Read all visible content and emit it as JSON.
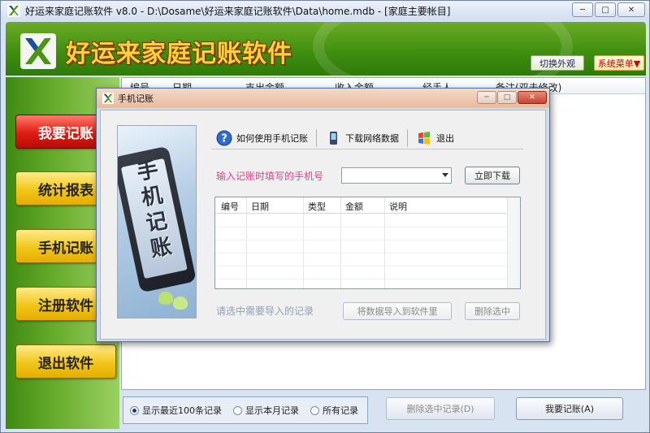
{
  "window": {
    "title": "好运来家庭记账软件 v8.0 - D:\\Dosame\\好运来家庭记账软件\\Data\\home.mdb - [家庭主要帐目]",
    "minimize": "─",
    "maximize": "□",
    "close": "✕"
  },
  "banner": {
    "brand": "好运来家庭记账软件",
    "skin_button": "切换外观",
    "system_menu_button": "系统菜单▼"
  },
  "nav": {
    "items": [
      {
        "label": "我要记账",
        "active": true
      },
      {
        "label": "统计报表",
        "active": false
      },
      {
        "label": "手机记账",
        "active": false
      },
      {
        "label": "注册软件",
        "active": false
      },
      {
        "label": "退出软件",
        "active": false
      }
    ]
  },
  "main_table": {
    "columns": [
      "编号",
      "日期",
      "支出金额",
      "收入金额",
      "经手人",
      "备注(双击修改)"
    ]
  },
  "bottom": {
    "radios": [
      {
        "label": "显示最近100条记录",
        "checked": true
      },
      {
        "label": "显示本月记录",
        "checked": false
      },
      {
        "label": "所有记录",
        "checked": false
      }
    ],
    "delete_selected": "删除选中记录(D)",
    "record_button": "我要记账(A)"
  },
  "dialog": {
    "title": "手机记账",
    "image_caption": "手机记账",
    "toolbar": {
      "help": "如何使用手机记账",
      "download": "下载网络数据",
      "exit": "退出"
    },
    "phone_label": "输入记账时填写的手机号",
    "phone_value": "",
    "download_now": "立即下载",
    "grid_columns": [
      "编号",
      "日期",
      "类型",
      "金额",
      "说明"
    ],
    "hint": "请选中需要导入的记录",
    "import_button": "将数据导入到软件里",
    "delete_button": "删除选中"
  },
  "colors": {
    "banner_green": "#4a9514",
    "nav_active": "#e01b12",
    "nav_normal": "#f1c619",
    "brand_text": "#ffd23a",
    "phone_label": "#e0408a"
  }
}
